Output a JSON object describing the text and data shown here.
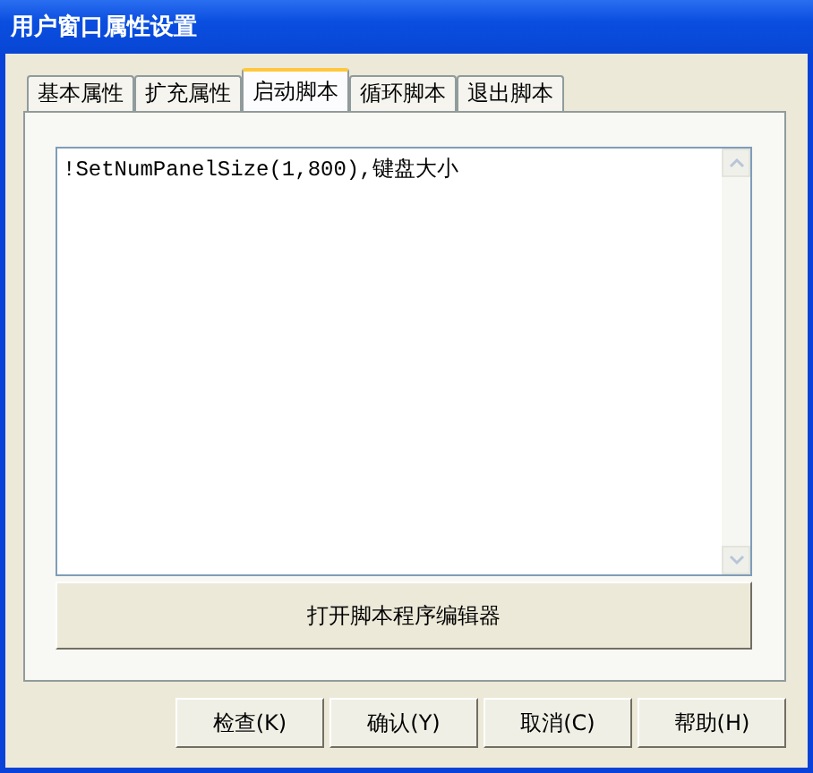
{
  "window": {
    "title": "用户窗口属性设置"
  },
  "tabs": [
    {
      "label": "基本属性",
      "selected": false
    },
    {
      "label": "扩充属性",
      "selected": false
    },
    {
      "label": "启动脚本",
      "selected": true
    },
    {
      "label": "循环脚本",
      "selected": false
    },
    {
      "label": "退出脚本",
      "selected": false
    }
  ],
  "script_editor": {
    "value": "!SetNumPanelSize(1,800),键盘大小"
  },
  "open_editor_button": "打开脚本程序编辑器",
  "buttons": [
    "检查(K)",
    "确认(Y)",
    "取消(C)",
    "帮助(H)"
  ]
}
